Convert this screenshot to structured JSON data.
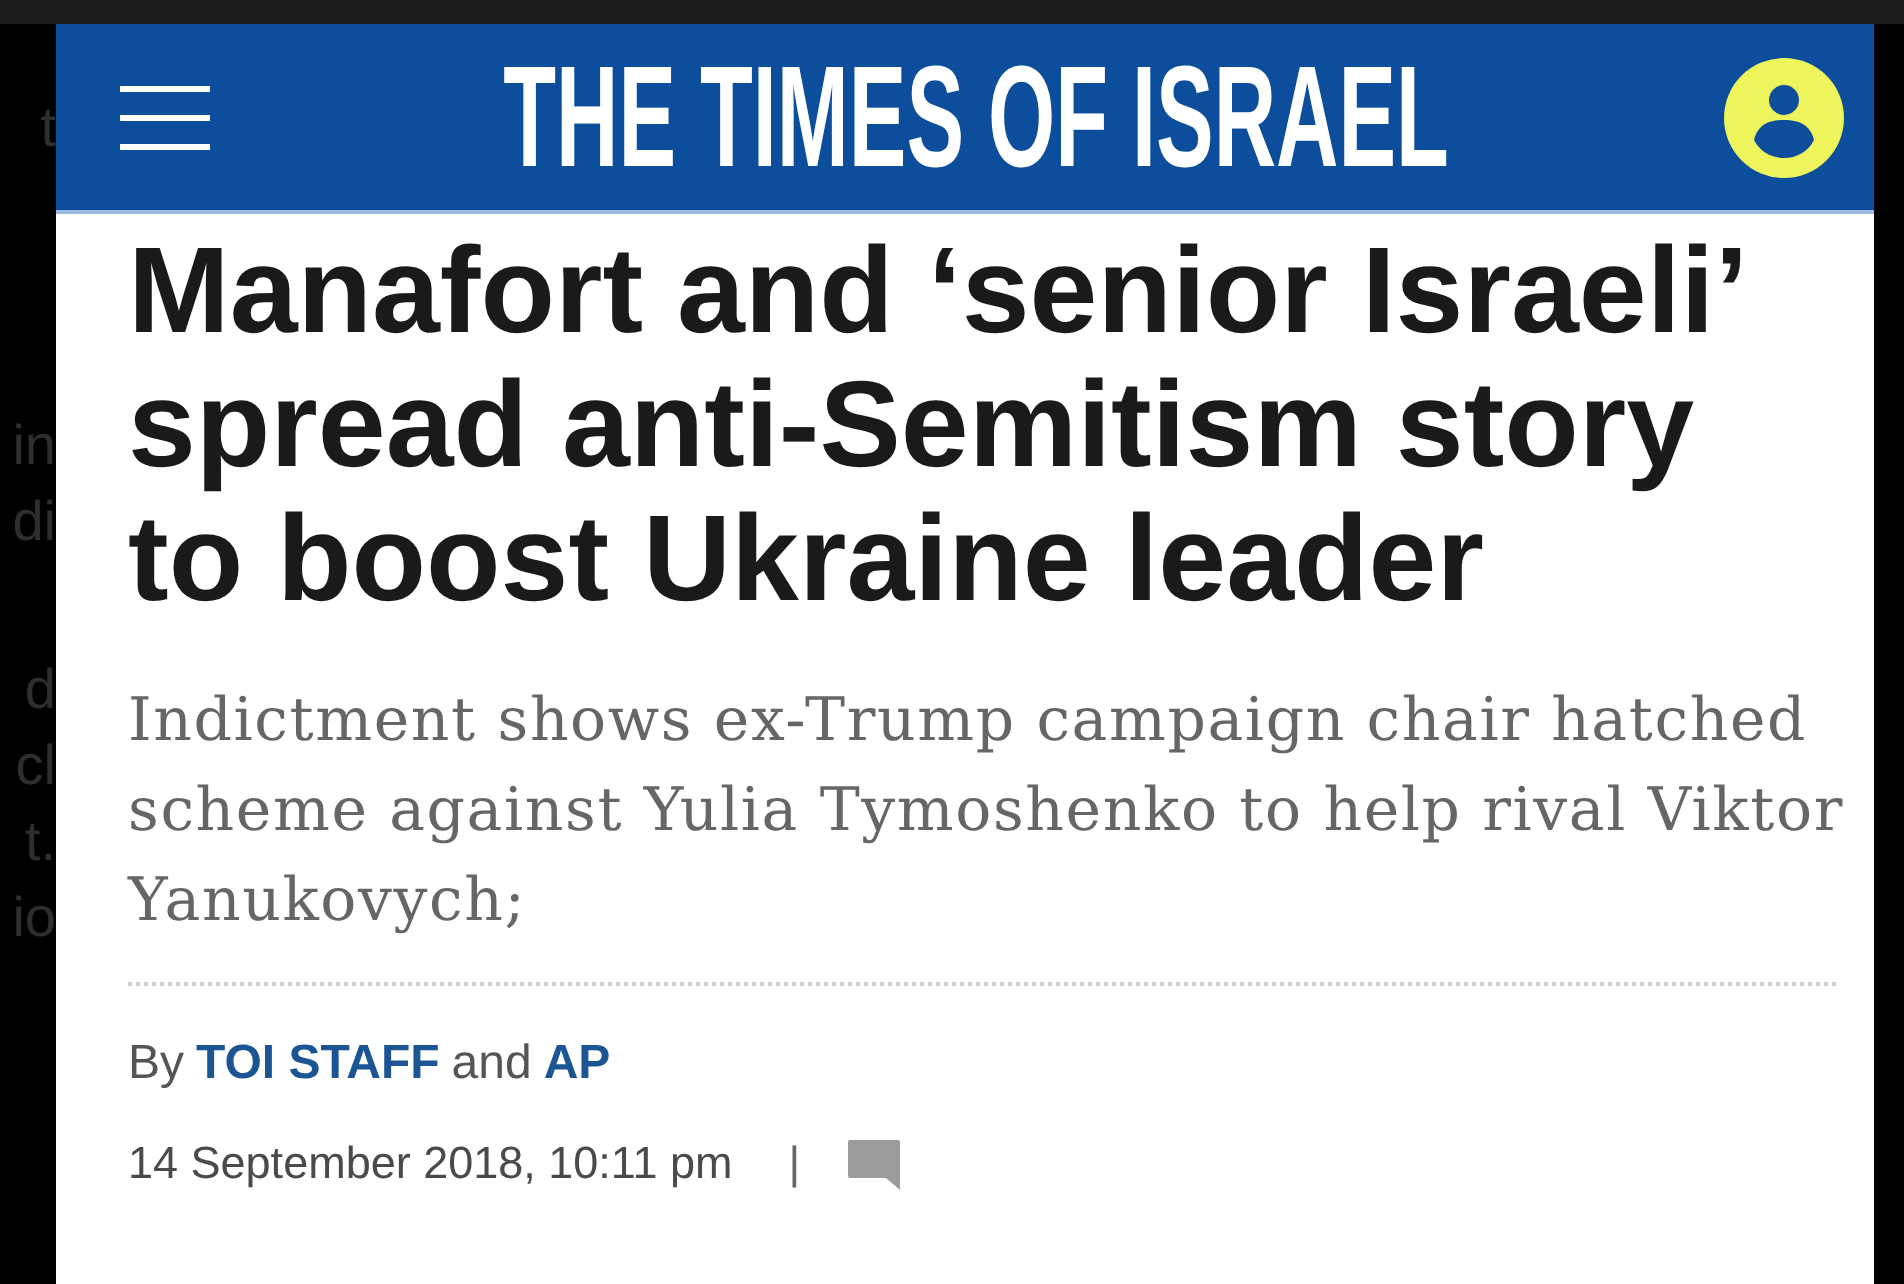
{
  "background_fragments": [
    [
      "t"
    ],
    [
      "in",
      "di"
    ],
    [
      "d",
      "cl",
      "t.",
      "io"
    ]
  ],
  "header": {
    "title": "THE TIMES OF ISRAEL"
  },
  "article": {
    "headline": "Manafort and ‘senior Israeli’ spread anti-Semitism story to boost Ukraine leader",
    "subheadline": "Indictment shows ex-Trump campaign chair hatched scheme against Yulia Tymoshenko to help rival Viktor Yanukovych;",
    "byline": {
      "prefix": "By",
      "authors": [
        "TOI STAFF",
        "AP"
      ],
      "joiner": "and"
    },
    "dateline": "14 September 2018, 10:11 pm",
    "separator": "|"
  }
}
